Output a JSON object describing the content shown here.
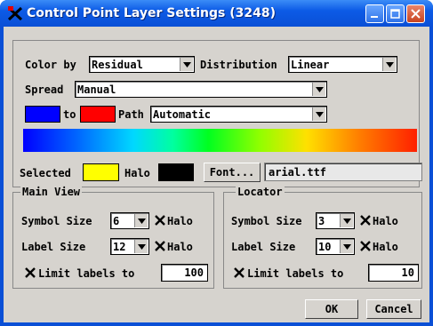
{
  "window": {
    "title": "Control Point Layer Settings (3248)"
  },
  "colorBy": {
    "label": "Color by",
    "value": "Residual"
  },
  "distribution": {
    "label": "Distribution",
    "value": "Linear"
  },
  "spread": {
    "label": "Spread",
    "value": "Manual"
  },
  "range": {
    "from_color": "#0000ff",
    "to_label": "to",
    "to_color": "#ff0000",
    "path_label": "Path",
    "path_value": "Automatic"
  },
  "selected": {
    "label": "Selected",
    "color": "#ffff00"
  },
  "halo": {
    "label": "Halo",
    "color": "#000000"
  },
  "font": {
    "button": "Font...",
    "value": "arial.ttf"
  },
  "mainView": {
    "title": "Main View",
    "symbolSize": {
      "label": "Symbol Size",
      "value": "6",
      "halo_label": "Halo",
      "halo_checked": true
    },
    "labelSize": {
      "label": "Label Size",
      "value": "12",
      "halo_label": "Halo",
      "halo_checked": true
    },
    "limit": {
      "label": "Limit labels to",
      "checked": true,
      "value": "100"
    }
  },
  "locator": {
    "title": "Locator",
    "symbolSize": {
      "label": "Symbol Size",
      "value": "3",
      "halo_label": "Halo",
      "halo_checked": true
    },
    "labelSize": {
      "label": "Label Size",
      "value": "10",
      "halo_label": "Halo",
      "halo_checked": true
    },
    "limit": {
      "label": "Limit labels to",
      "checked": true,
      "value": "10"
    }
  },
  "buttons": {
    "ok": "OK",
    "cancel": "Cancel"
  }
}
